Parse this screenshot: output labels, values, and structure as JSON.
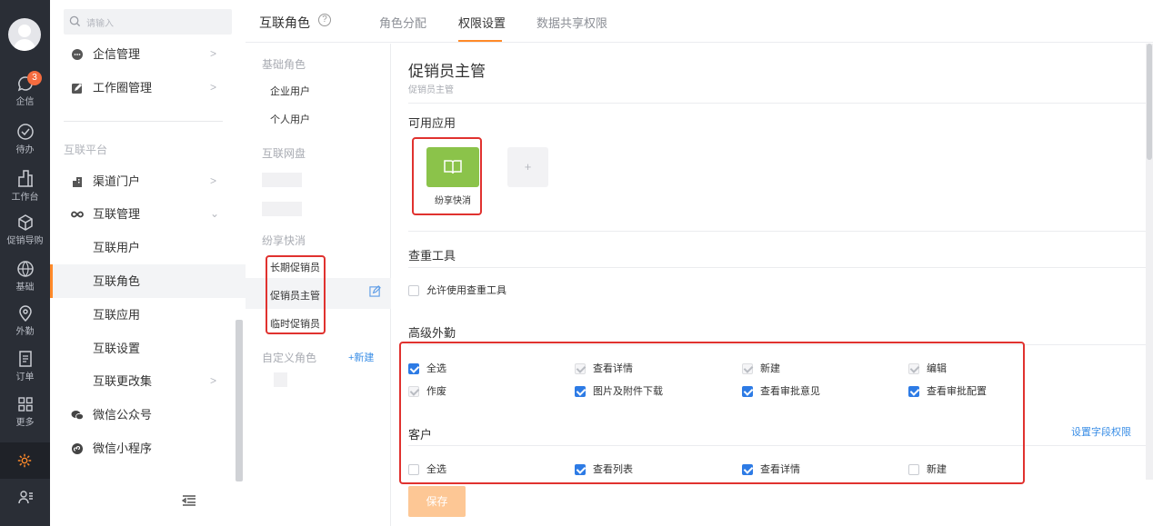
{
  "rail": {
    "badge": "3",
    "items": [
      "企信",
      "待办",
      "工作台",
      "促销导购",
      "基础",
      "外勤",
      "订单",
      "更多"
    ]
  },
  "nav": {
    "search_placeholder": "请输入",
    "items_top": [
      {
        "label": "企信管理",
        "arrow": ">"
      },
      {
        "label": "工作圈管理",
        "arrow": ">"
      }
    ],
    "group": "互联平台",
    "items": [
      {
        "label": "渠道门户",
        "arrow": ">"
      },
      {
        "label": "互联管理",
        "arrow": "⌄"
      },
      {
        "label": "互联用户"
      },
      {
        "label": "互联角色"
      },
      {
        "label": "互联应用"
      },
      {
        "label": "互联设置"
      },
      {
        "label": "互联更改集",
        "arrow": ">"
      },
      {
        "label": "微信公众号"
      },
      {
        "label": "微信小程序"
      }
    ]
  },
  "header": {
    "title": "互联角色",
    "help": "?",
    "tabs": [
      "角色分配",
      "权限设置",
      "数据共享权限"
    ]
  },
  "roles": {
    "base_group": "基础角色",
    "base_items": [
      "企业用户",
      "个人用户"
    ],
    "disk_group": "互联网盘",
    "promo_group": "纷享快消",
    "promo_items": [
      "长期促销员",
      "促销员主管",
      "临时促销员"
    ],
    "custom_group": "自定义角色",
    "new_label": "+新建"
  },
  "main": {
    "title": "促销员主管",
    "subtitle": "促销员主管",
    "apps_section": "可用应用",
    "app_label": "纷享快消",
    "add_label": "+",
    "dup_section": "查重工具",
    "dup_option": "允许使用查重工具",
    "adv_section": "高级外勤",
    "adv_options": [
      "全选",
      "查看详情",
      "新建",
      "编辑",
      "作废",
      "图片及附件下载",
      "查看审批意见",
      "查看审批配置"
    ],
    "customer_section": "客户",
    "field_perm_link": "设置字段权限",
    "customer_options": [
      "全选",
      "查看列表",
      "查看详情",
      "新建"
    ],
    "save": "保存"
  }
}
